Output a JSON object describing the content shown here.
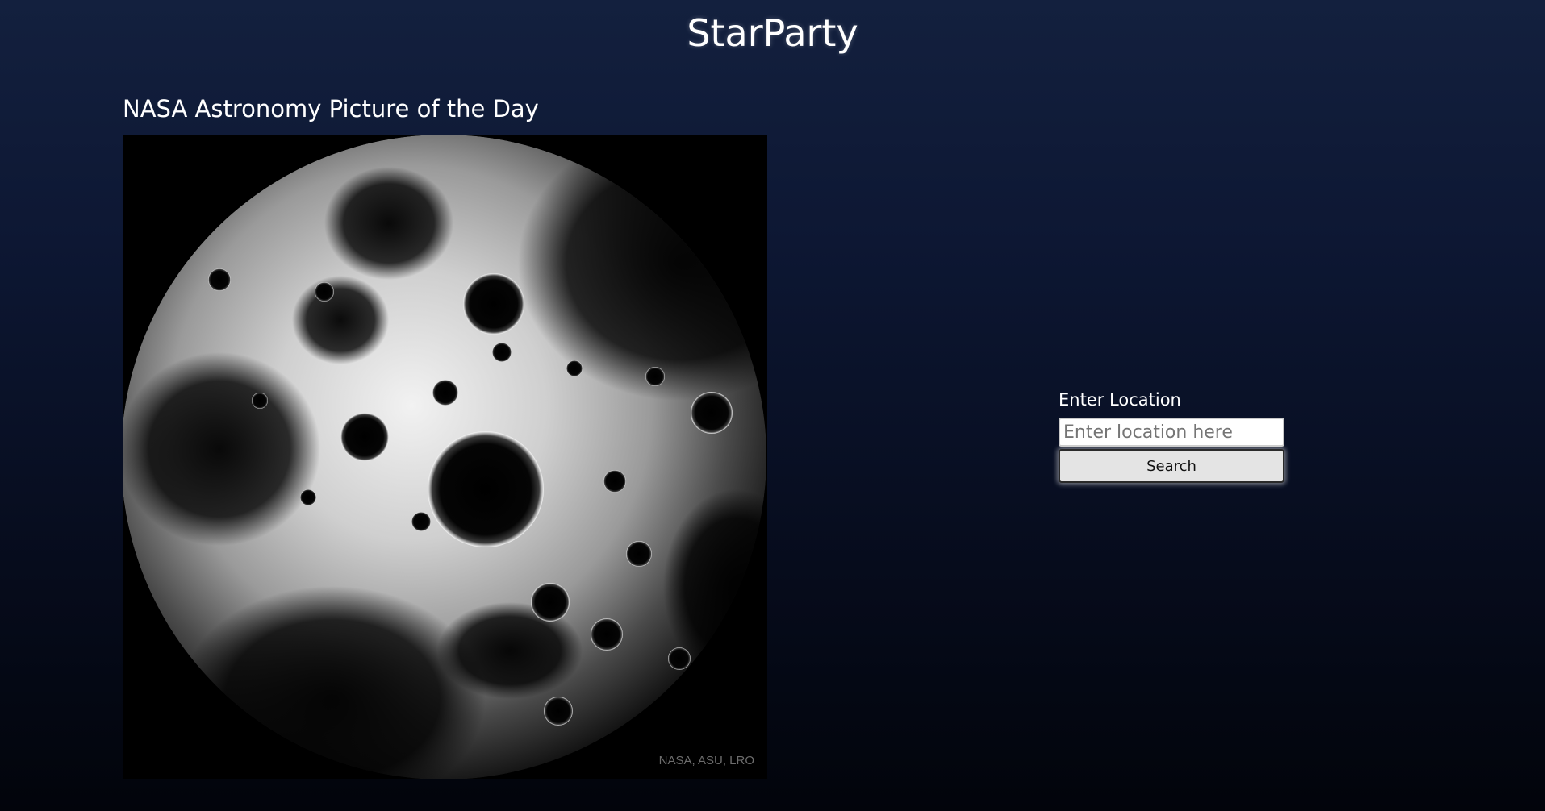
{
  "header": {
    "site_title": "StarParty"
  },
  "apod": {
    "heading": "NASA Astronomy Picture of the Day",
    "image_credit": "NASA, ASU, LRO"
  },
  "location": {
    "label": "Enter Location",
    "placeholder": "Enter location here",
    "value": "",
    "search_label": "Search"
  },
  "colors": {
    "background_top": "#13203e",
    "background_bottom": "#02040b",
    "text": "#ffffff",
    "button_bg": "#e4e4e4"
  }
}
